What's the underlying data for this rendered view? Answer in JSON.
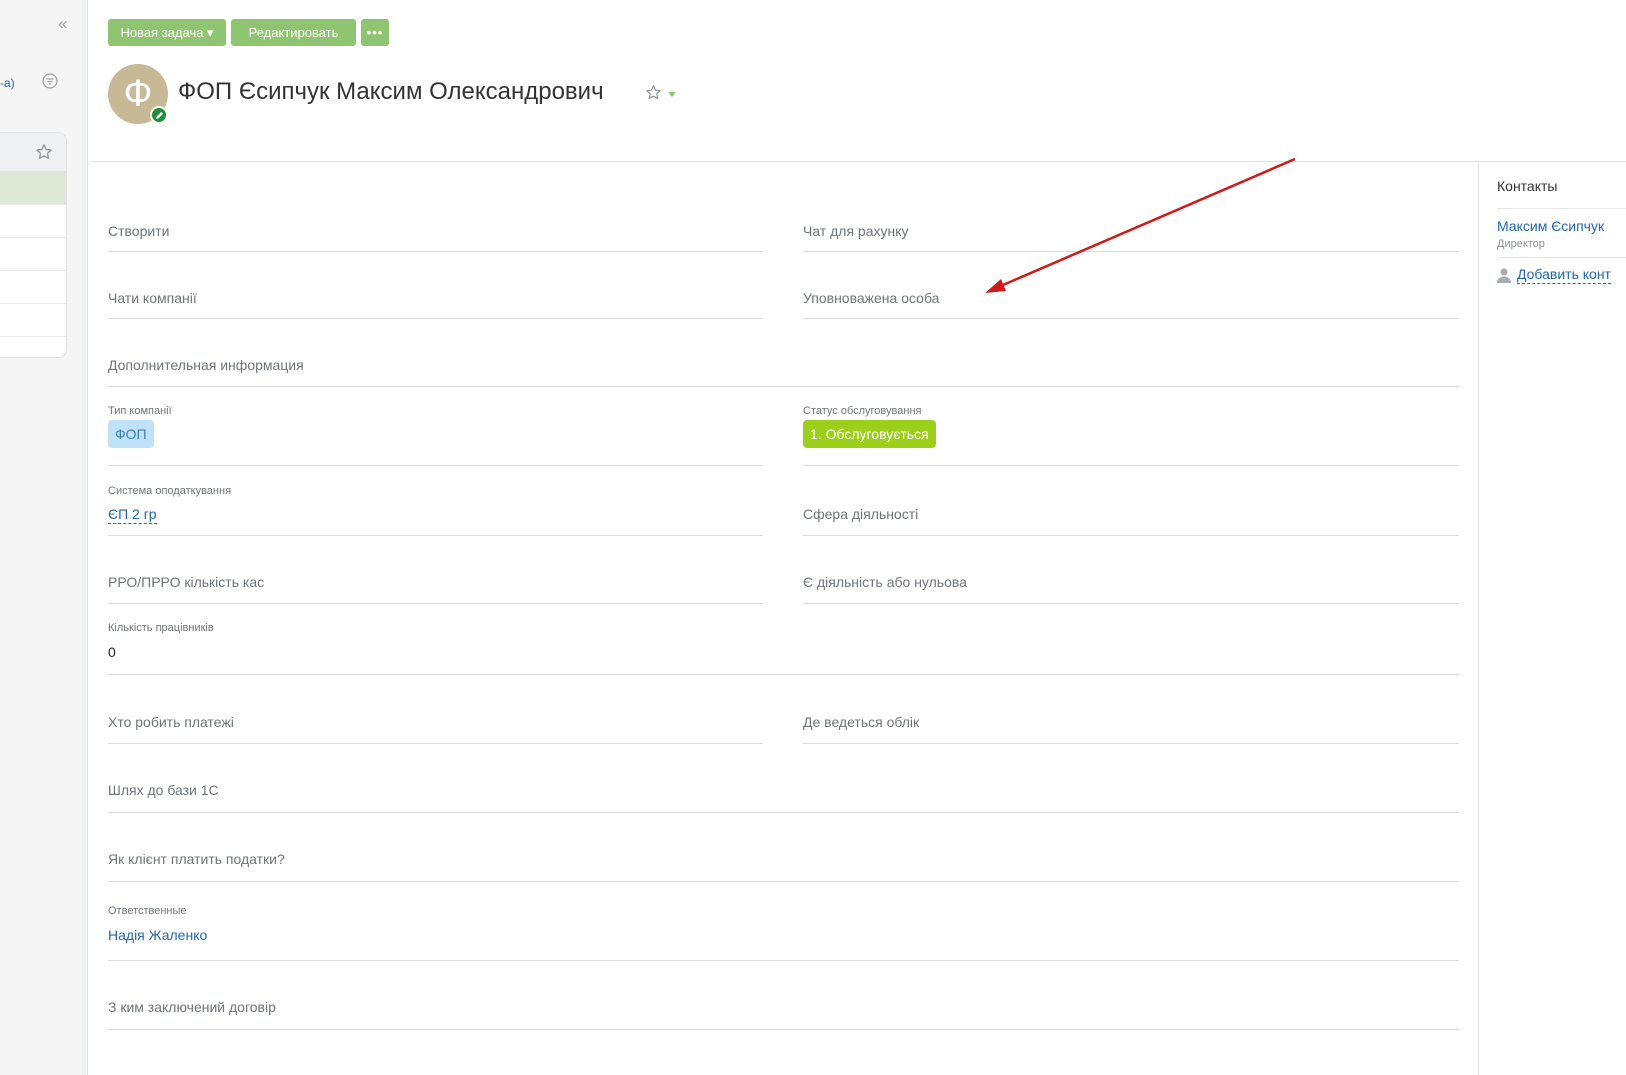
{
  "left_panel": {
    "link_fragment": "-а)"
  },
  "toolbar": {
    "new_task": "Новая задача ▾",
    "edit": "Редактировать",
    "more": "•••"
  },
  "header": {
    "avatar_letter": "Ф",
    "title": "ФОП Єсипчук Максим Олександрович"
  },
  "fields": {
    "create": "Створити",
    "chat_invoice": "Чат для рахунку",
    "company_chats": "Чати компанії",
    "authorized_person": "Уповноважена особа",
    "additional_info": "Дополнительная информация",
    "company_type": {
      "label": "Тип компанії",
      "value": "ФОП"
    },
    "service_status": {
      "label": "Статус обслуговування",
      "value": "1. Обслуговується"
    },
    "tax_system": {
      "label": "Система оподаткування",
      "value": "ЄП 2 гр"
    },
    "activity_sphere": "Сфера діяльності",
    "cash_registers": "РРО/ПРРО кількість кас",
    "activity_or_zero": "Є діяльність або нульова",
    "employees": {
      "label": "Кількість працівників",
      "value": "0"
    },
    "who_pays": "Хто робить платежі",
    "where_accounting": "Де ведеться облік",
    "path_1c": "Шлях до бази 1С",
    "how_pays_taxes": "Як клієнт платить податки?",
    "responsible": {
      "label": "Ответственные",
      "value": "Надія Жаленко"
    },
    "contract_with": "З ким заключений договір"
  },
  "sidebar": {
    "title": "Контакты",
    "contact_name": "Максим Єсипчук",
    "contact_role": "Директор",
    "add_contact": "Добавить конт"
  },
  "colors": {
    "accent_green": "#8fc470",
    "status_green": "#9ccf1a",
    "tag_blue": "#bfe2f8",
    "link_blue": "#2067b0",
    "annotation_red": "#d0191b"
  }
}
